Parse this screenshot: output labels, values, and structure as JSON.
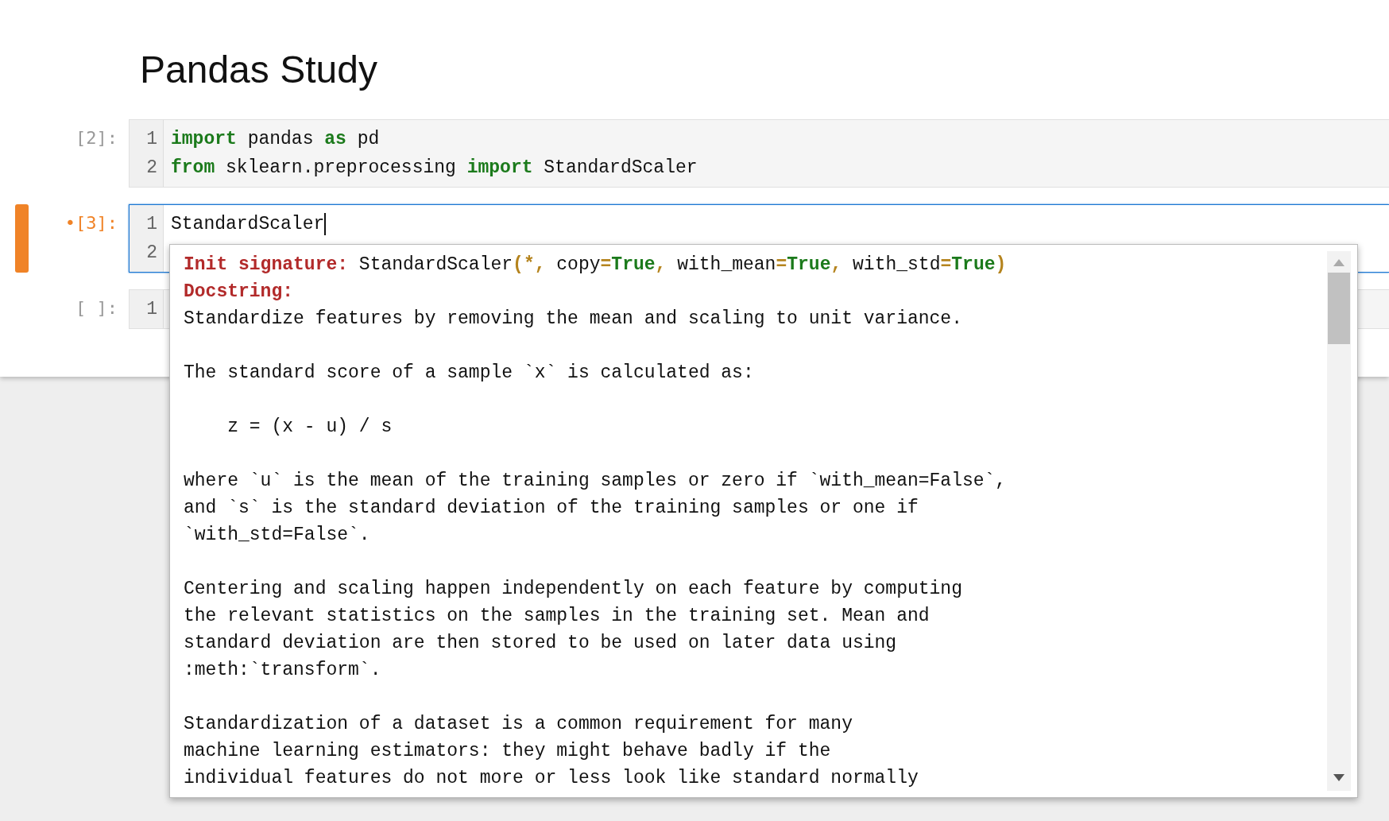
{
  "title": "Pandas Study",
  "cells": [
    {
      "prompt": "[2]:",
      "active": false,
      "lines": [
        [
          {
            "text": "import",
            "kind": "keyword"
          },
          {
            "text": " pandas ",
            "kind": "plain"
          },
          {
            "text": "as",
            "kind": "keyword"
          },
          {
            "text": " pd",
            "kind": "plain"
          }
        ],
        [
          {
            "text": "from",
            "kind": "keyword"
          },
          {
            "text": " sklearn.preprocessing ",
            "kind": "plain"
          },
          {
            "text": "import",
            "kind": "keyword"
          },
          {
            "text": " StandardScaler",
            "kind": "plain"
          }
        ]
      ],
      "line_numbers": [
        "1",
        "2"
      ]
    },
    {
      "prompt": "•[3]:",
      "active": true,
      "lines": [
        [
          {
            "text": "StandardScaler",
            "kind": "plain"
          }
        ]
      ],
      "line_numbers": [
        "1",
        "2"
      ]
    },
    {
      "prompt": "[ ]:",
      "active": false,
      "line_numbers": [
        "1"
      ]
    }
  ],
  "tooltip": {
    "signature_label": "Init signature:",
    "signature": [
      {
        "text": " StandardScaler",
        "kind": "plain"
      },
      {
        "text": "(*,",
        "kind": "punct"
      },
      {
        "text": " copy",
        "kind": "plain"
      },
      {
        "text": "=",
        "kind": "punct"
      },
      {
        "text": "True",
        "kind": "keyword"
      },
      {
        "text": ",",
        "kind": "punct"
      },
      {
        "text": " with_mean",
        "kind": "plain"
      },
      {
        "text": "=",
        "kind": "punct"
      },
      {
        "text": "True",
        "kind": "keyword"
      },
      {
        "text": ",",
        "kind": "punct"
      },
      {
        "text": " with_std",
        "kind": "plain"
      },
      {
        "text": "=",
        "kind": "punct"
      },
      {
        "text": "True",
        "kind": "keyword"
      },
      {
        "text": ")",
        "kind": "punct"
      }
    ],
    "docstring_label": "Docstring:",
    "paragraphs": [
      [
        "Standardize features by removing the mean and scaling to unit variance."
      ],
      [
        "The standard score of a sample `x` is calculated as:"
      ],
      [
        "    z = (x - u) / s"
      ],
      [
        "where `u` is the mean of the training samples or zero if `with_mean=False`,",
        "and `s` is the standard deviation of the training samples or one if",
        "`with_std=False`."
      ],
      [
        "Centering and scaling happen independently on each feature by computing",
        "the relevant statistics on the samples in the training set. Mean and",
        "standard deviation are then stored to be used on later data using",
        ":meth:`transform`."
      ],
      [
        "Standardization of a dataset is a common requirement for many",
        "machine learning estimators: they might behave badly if the",
        "individual features do not more or less look like standard normally"
      ]
    ]
  }
}
